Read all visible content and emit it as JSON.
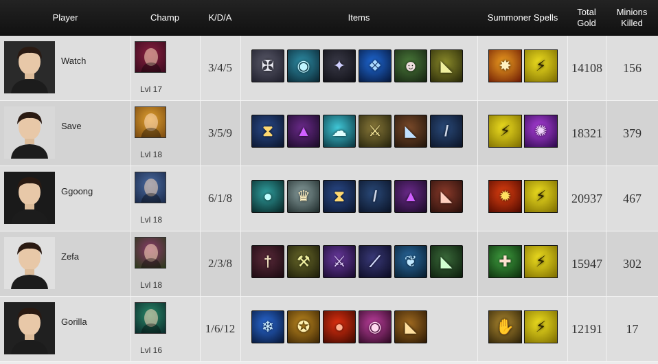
{
  "header": {
    "player": "Player",
    "champ": "Champ",
    "kda": "K/D/A",
    "items": "Items",
    "spells": "Summoner Spells",
    "gold_line1": "Total",
    "gold_line2": "Gold",
    "minions_line1": "Minions",
    "minions_line2": "Killed"
  },
  "players": [
    {
      "name": "Watch",
      "level": "Lvl 17",
      "kda": "3/4/5",
      "gold": "14108",
      "minions": "156",
      "champ_colors": [
        "#3a0b1e",
        "#8a2040"
      ],
      "portrait_bg": "#2a2a2a",
      "items": [
        {
          "icon": "shield-banner-icon",
          "glyph": "✠",
          "c1": "#5a5a6a",
          "c2": "#1c1c28",
          "fg": "#e8e8f0"
        },
        {
          "icon": "eye-icon",
          "glyph": "◉",
          "c1": "#2e8fa8",
          "c2": "#0a2430",
          "fg": "#bff4ff"
        },
        {
          "icon": "dark-helm-icon",
          "glyph": "✦",
          "c1": "#3a3a48",
          "c2": "#0e0e14",
          "fg": "#d0d0ff"
        },
        {
          "icon": "blue-crest-icon",
          "glyph": "❖",
          "c1": "#1f6ad8",
          "c2": "#061638",
          "fg": "#a8d8ff"
        },
        {
          "icon": "mask-icon",
          "glyph": "☻",
          "c1": "#4a7a3a",
          "c2": "#142010",
          "fg": "#f0e0e0"
        },
        {
          "icon": "green-boots-icon",
          "glyph": "◣",
          "c1": "#8a8a2a",
          "c2": "#262608",
          "fg": "#f0f0a0"
        }
      ],
      "spells": [
        {
          "icon": "smite-icon",
          "glyph": "✸",
          "c1": "#f0a020",
          "c2": "#6a1804",
          "fg": "#fff2c0"
        },
        {
          "icon": "flash-icon",
          "glyph": "⚡",
          "c1": "#f0e020",
          "c2": "#7a6a00",
          "fg": "#2a2000"
        }
      ]
    },
    {
      "name": "Save",
      "level": "Lvl 18",
      "kda": "3/5/9",
      "gold": "18321",
      "minions": "379",
      "champ_colors": [
        "#7a4a10",
        "#e0a030"
      ],
      "portrait_bg": "#d8d8d8",
      "items": [
        {
          "icon": "hourglass-icon",
          "glyph": "⧗",
          "c1": "#2a4a8a",
          "c2": "#0a142a",
          "fg": "#ffd870"
        },
        {
          "icon": "wizard-hat-icon",
          "glyph": "▲",
          "c1": "#6a2a8a",
          "c2": "#180a24",
          "fg": "#d060ff"
        },
        {
          "icon": "ghost-icon",
          "glyph": "☁",
          "c1": "#40c8d8",
          "c2": "#08303a",
          "fg": "#e0ffff"
        },
        {
          "icon": "sword-icon",
          "glyph": "⚔",
          "c1": "#8a7a3a",
          "c2": "#22200a",
          "fg": "#fff0a0"
        },
        {
          "icon": "boots-icon",
          "glyph": "◣",
          "c1": "#7a4a2a",
          "c2": "#20140a",
          "fg": "#c0e0ff"
        },
        {
          "icon": "staff-icon",
          "glyph": "/",
          "c1": "#2a4a7a",
          "c2": "#0a1224",
          "fg": "#d0d8e8"
        }
      ],
      "spells": [
        {
          "icon": "flash-icon",
          "glyph": "⚡",
          "c1": "#f0e020",
          "c2": "#7a6a00",
          "fg": "#2a2000"
        },
        {
          "icon": "teleport-icon",
          "glyph": "✺",
          "c1": "#b040e0",
          "c2": "#2a0848",
          "fg": "#f4d8ff"
        }
      ]
    },
    {
      "name": "Ggoong",
      "level": "Lvl 18",
      "kda": "6/1/8",
      "gold": "20937",
      "minions": "467",
      "champ_colors": [
        "#1a2a4a",
        "#4a6aa0"
      ],
      "portrait_bg": "#1a1a1a",
      "items": [
        {
          "icon": "orb-staff-icon",
          "glyph": "●",
          "c1": "#30a0a0",
          "c2": "#062020",
          "fg": "#c0ffff"
        },
        {
          "icon": "winged-helm-icon",
          "glyph": "♛",
          "c1": "#8aa0a0",
          "c2": "#1c2828",
          "fg": "#fff0c0"
        },
        {
          "icon": "hourglass-icon",
          "glyph": "⧗",
          "c1": "#2a4a8a",
          "c2": "#0a142a",
          "fg": "#ffd870"
        },
        {
          "icon": "staff-icon",
          "glyph": "/",
          "c1": "#2a4a7a",
          "c2": "#0a1224",
          "fg": "#d0d8e8"
        },
        {
          "icon": "wizard-hat-icon",
          "glyph": "▲",
          "c1": "#6a2a8a",
          "c2": "#180a24",
          "fg": "#d060ff"
        },
        {
          "icon": "armored-boots-icon",
          "glyph": "◣",
          "c1": "#8a3a2a",
          "c2": "#240e0a",
          "fg": "#ffd0c0"
        }
      ],
      "spells": [
        {
          "icon": "ignite-icon",
          "glyph": "✹",
          "c1": "#e04010",
          "c2": "#4a0800",
          "fg": "#ffe060"
        },
        {
          "icon": "flash-icon",
          "glyph": "⚡",
          "c1": "#f0e020",
          "c2": "#7a6a00",
          "fg": "#2a2000"
        }
      ]
    },
    {
      "name": "Zefa",
      "level": "Lvl 18",
      "kda": "2/3/8",
      "gold": "15947",
      "minions": "302",
      "champ_colors": [
        "#2a3a1a",
        "#8a3a6a"
      ],
      "portrait_bg": "#e0e0e0",
      "items": [
        {
          "icon": "dagger-icon",
          "glyph": "†",
          "c1": "#5a2a3a",
          "c2": "#18080e",
          "fg": "#f0e0c0"
        },
        {
          "icon": "cleaver-icon",
          "glyph": "⚒",
          "c1": "#6a6a2a",
          "c2": "#1a1a08",
          "fg": "#f0f0a0"
        },
        {
          "icon": "greatsword-icon",
          "glyph": "⚔",
          "c1": "#6a3aa0",
          "c2": "#140828",
          "fg": "#e8d8ff"
        },
        {
          "icon": "blade-icon",
          "glyph": "⟋",
          "c1": "#3a3a7a",
          "c2": "#0a0a20",
          "fg": "#d8e0ff"
        },
        {
          "icon": "bow-icon",
          "glyph": "❦",
          "c1": "#2a6aa0",
          "c2": "#061a2a",
          "fg": "#c0e8ff"
        },
        {
          "icon": "mercury-boots-icon",
          "glyph": "◣",
          "c1": "#3a6a3a",
          "c2": "#0a1a0a",
          "fg": "#d0ffd0"
        }
      ],
      "spells": [
        {
          "icon": "heal-icon",
          "glyph": "✚",
          "c1": "#40a040",
          "c2": "#0a2a0a",
          "fg": "#ffe0d0"
        },
        {
          "icon": "flash-icon",
          "glyph": "⚡",
          "c1": "#f0e020",
          "c2": "#7a6a00",
          "fg": "#2a2000"
        }
      ]
    },
    {
      "name": "Gorilla",
      "level": "Lvl 16",
      "kda": "1/6/12",
      "gold": "12191",
      "minions": "17",
      "champ_colors": [
        "#0a2a2a",
        "#2a8a6a"
      ],
      "portrait_bg": "#202020",
      "items": [
        {
          "icon": "frost-blade-icon",
          "glyph": "❄",
          "c1": "#2a6ad8",
          "c2": "#061430",
          "fg": "#d0f0ff"
        },
        {
          "icon": "golden-crest-icon",
          "glyph": "✪",
          "c1": "#c08a20",
          "c2": "#3a2404",
          "fg": "#fff0b0"
        },
        {
          "icon": "red-orb-icon",
          "glyph": "●",
          "c1": "#e03010",
          "c2": "#3a0800",
          "fg": "#ffb090"
        },
        {
          "icon": "pink-eye-icon",
          "glyph": "◉",
          "c1": "#c040a0",
          "c2": "#2a0820",
          "fg": "#ffd8f0"
        },
        {
          "icon": "warding-boots-icon",
          "glyph": "◣",
          "c1": "#a06a20",
          "c2": "#2a1804",
          "fg": "#ffe0a0"
        }
      ],
      "spells": [
        {
          "icon": "exhaust-icon",
          "glyph": "✋",
          "c1": "#b08a30",
          "c2": "#2a2008",
          "fg": "#f0f0f0"
        },
        {
          "icon": "flash-icon",
          "glyph": "⚡",
          "c1": "#f0e020",
          "c2": "#7a6a00",
          "fg": "#2a2000"
        }
      ]
    }
  ]
}
